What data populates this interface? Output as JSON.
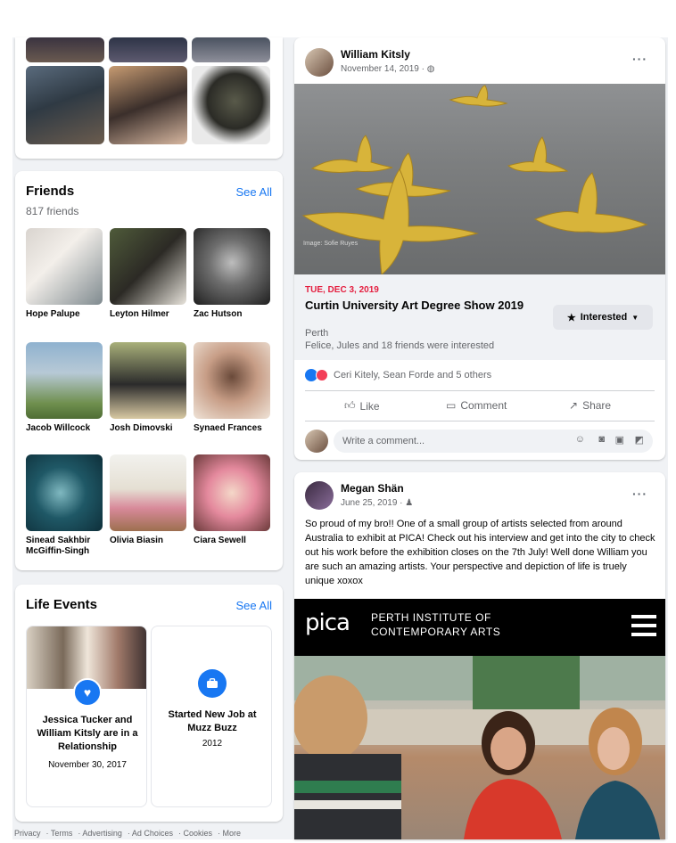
{
  "friends": {
    "title": "Friends",
    "see_all": "See All",
    "count": "817 friends",
    "list": [
      {
        "name": "Hope Palupe"
      },
      {
        "name": "Leyton Hilmer"
      },
      {
        "name": "Zac Hutson"
      },
      {
        "name": "Jacob Willcock"
      },
      {
        "name": "Josh Dimovski"
      },
      {
        "name": "Synaed Frances"
      },
      {
        "name": "Sinead Sakhbir McGiffin-Singh"
      },
      {
        "name": "Olivia Biasin"
      },
      {
        "name": "Ciara Sewell"
      }
    ]
  },
  "life_events": {
    "title": "Life Events",
    "see_all": "See All",
    "events": [
      {
        "title": "Jessica Tucker and William Kitsly are in a Relationship",
        "date": "November 30, 2017"
      },
      {
        "title": "Started New Job at Muzz Buzz",
        "date": "2012"
      }
    ]
  },
  "footer": {
    "links": [
      "Privacy",
      "Terms",
      "Advertising",
      "Ad Choices",
      "Cookies",
      "More"
    ]
  },
  "post1": {
    "author": "William Kitsly",
    "date": "November 14, 2019 ·",
    "photo_credit": "Image: Sofie Ruyes",
    "event": {
      "date": "TUE, DEC 3, 2019",
      "title": "Curtin University Art Degree Show 2019",
      "location": "Perth",
      "interested_text": "Felice, Jules and 18 friends were interested",
      "button": "Interested"
    },
    "reactions": "Ceri Kitely, Sean Forde and 5 others",
    "actions": {
      "like": "Like",
      "comment": "Comment",
      "share": "Share"
    },
    "comment_placeholder": "Write a comment..."
  },
  "post2": {
    "author": "Megan Shän",
    "date": "June 25, 2019 ·",
    "text": "So proud of my bro!! One of a small group of artists selected from around Australia to exhibit at PICA! Check out his interview and get into the city to check out his work before the exhibition closes on the 7th July! Well done William you are such an amazing artists. Your perspective and depiction of life is truely unique xoxox",
    "pica": {
      "logo": "pica",
      "line1": "PERTH INSTITUTE OF",
      "line2": "CONTEMPORARY ARTS"
    }
  },
  "colors": {
    "accent": "#1877f2",
    "event_date": "#e41e3f",
    "pica_bg": "#000000",
    "page_bg": "#f0f2f5"
  }
}
